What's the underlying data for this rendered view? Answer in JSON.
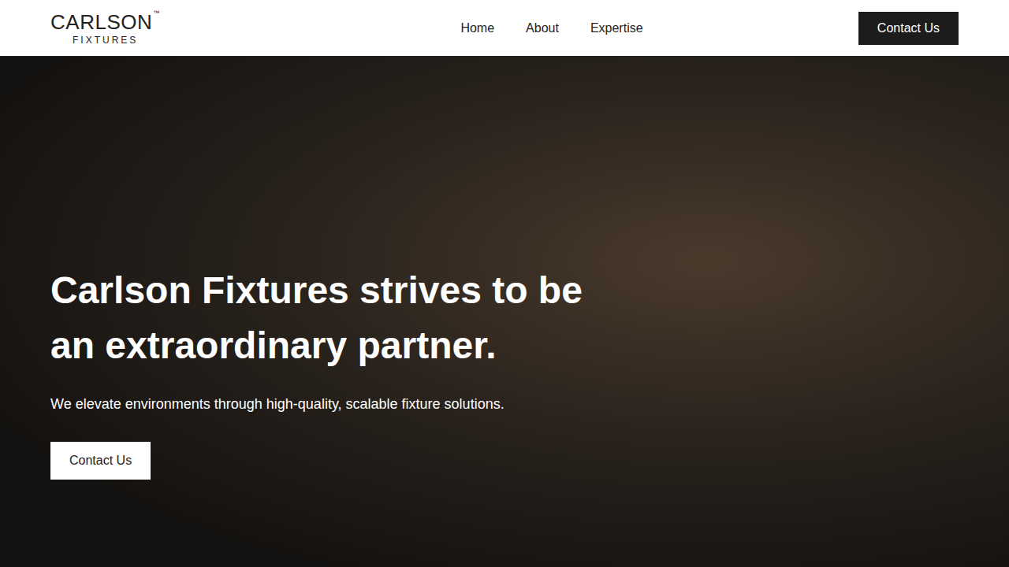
{
  "header": {
    "logo": {
      "name": "CARLSON",
      "mark": "™",
      "subtitle": "FIXTURES"
    },
    "nav": [
      {
        "label": "Home"
      },
      {
        "label": "About"
      },
      {
        "label": "Expertise"
      }
    ],
    "cta": "Contact Us"
  },
  "hero": {
    "heading_lines": [
      "Carlson Fixtures strives to be",
      "an extraordinary partner."
    ],
    "subheading": "We elevate environments through high-quality, scalable fixture solutions.",
    "button": "Contact Us"
  }
}
